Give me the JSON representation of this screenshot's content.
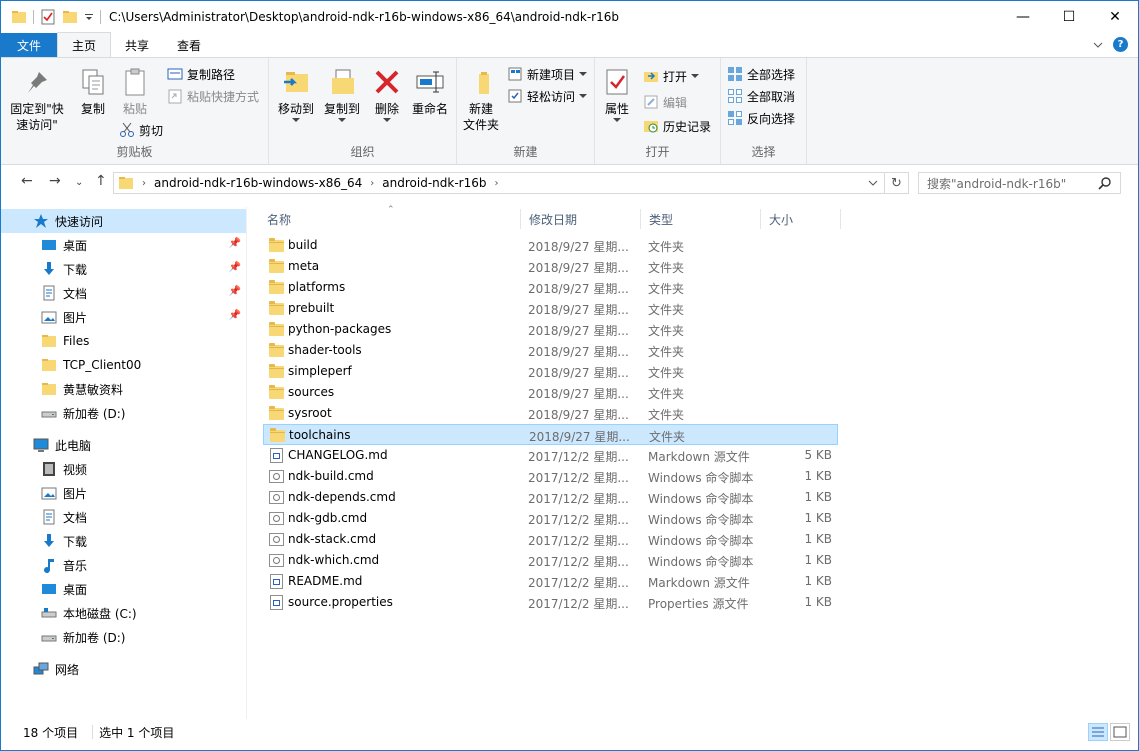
{
  "window": {
    "title": "C:\\Users\\Administrator\\Desktop\\android-ndk-r16b-windows-x86_64\\android-ndk-r16b",
    "minimize": "—",
    "maximize": "☐",
    "close": "✕"
  },
  "tabs": {
    "file": "文件",
    "home": "主页",
    "share": "共享",
    "view": "查看"
  },
  "ribbon": {
    "clipboard": {
      "label": "剪贴板",
      "pin_line1": "固定到\"快",
      "pin_line2": "速访问\"",
      "copy": "复制",
      "paste": "粘贴",
      "copy_path": "复制路径",
      "paste_shortcut": "粘贴快捷方式",
      "cut": "剪切"
    },
    "organize": {
      "label": "组织",
      "move_to": "移动到",
      "copy_to": "复制到",
      "delete": "删除",
      "rename": "重命名"
    },
    "new": {
      "label": "新建",
      "new_folder_line1": "新建",
      "new_folder_line2": "文件夹",
      "new_item": "新建项目",
      "easy_access": "轻松访问"
    },
    "open": {
      "label": "打开",
      "properties": "属性",
      "open": "打开",
      "edit": "编辑",
      "history": "历史记录"
    },
    "select": {
      "label": "选择",
      "select_all": "全部选择",
      "select_none": "全部取消",
      "invert": "反向选择"
    }
  },
  "address": {
    "crumbs": [
      "android-ndk-r16b-windows-x86_64",
      "android-ndk-r16b"
    ],
    "search_placeholder": "搜索\"android-ndk-r16b\""
  },
  "navpane": {
    "quick_access": "快速访问",
    "qa_items": [
      "桌面",
      "下载",
      "文档",
      "图片",
      "Files",
      "TCP_Client00",
      "黄慧敏资料",
      "新加卷 (D:)"
    ],
    "this_pc": "此电脑",
    "pc_items": [
      "视频",
      "图片",
      "文档",
      "下载",
      "音乐",
      "桌面",
      "本地磁盘 (C:)",
      "新加卷 (D:)"
    ],
    "network": "网络"
  },
  "columns": {
    "name": "名称",
    "date": "修改日期",
    "type": "类型",
    "size": "大小"
  },
  "files": [
    {
      "name": "build",
      "date": "2018/9/27 星期...",
      "type": "文件夹",
      "size": "",
      "kind": "folder"
    },
    {
      "name": "meta",
      "date": "2018/9/27 星期...",
      "type": "文件夹",
      "size": "",
      "kind": "folder"
    },
    {
      "name": "platforms",
      "date": "2018/9/27 星期...",
      "type": "文件夹",
      "size": "",
      "kind": "folder"
    },
    {
      "name": "prebuilt",
      "date": "2018/9/27 星期...",
      "type": "文件夹",
      "size": "",
      "kind": "folder"
    },
    {
      "name": "python-packages",
      "date": "2018/9/27 星期...",
      "type": "文件夹",
      "size": "",
      "kind": "folder"
    },
    {
      "name": "shader-tools",
      "date": "2018/9/27 星期...",
      "type": "文件夹",
      "size": "",
      "kind": "folder"
    },
    {
      "name": "simpleperf",
      "date": "2018/9/27 星期...",
      "type": "文件夹",
      "size": "",
      "kind": "folder"
    },
    {
      "name": "sources",
      "date": "2018/9/27 星期...",
      "type": "文件夹",
      "size": "",
      "kind": "folder"
    },
    {
      "name": "sysroot",
      "date": "2018/9/27 星期...",
      "type": "文件夹",
      "size": "",
      "kind": "folder"
    },
    {
      "name": "toolchains",
      "date": "2018/9/27 星期...",
      "type": "文件夹",
      "size": "",
      "kind": "folder"
    },
    {
      "name": "CHANGELOG.md",
      "date": "2017/12/2 星期...",
      "type": "Markdown 源文件",
      "size": "5 KB",
      "kind": "doc"
    },
    {
      "name": "ndk-build.cmd",
      "date": "2017/12/2 星期...",
      "type": "Windows 命令脚本",
      "size": "1 KB",
      "kind": "cmd"
    },
    {
      "name": "ndk-depends.cmd",
      "date": "2017/12/2 星期...",
      "type": "Windows 命令脚本",
      "size": "1 KB",
      "kind": "cmd"
    },
    {
      "name": "ndk-gdb.cmd",
      "date": "2017/12/2 星期...",
      "type": "Windows 命令脚本",
      "size": "1 KB",
      "kind": "cmd"
    },
    {
      "name": "ndk-stack.cmd",
      "date": "2017/12/2 星期...",
      "type": "Windows 命令脚本",
      "size": "1 KB",
      "kind": "cmd"
    },
    {
      "name": "ndk-which.cmd",
      "date": "2017/12/2 星期...",
      "type": "Windows 命令脚本",
      "size": "1 KB",
      "kind": "cmd"
    },
    {
      "name": "README.md",
      "date": "2017/12/2 星期...",
      "type": "Markdown 源文件",
      "size": "1 KB",
      "kind": "doc"
    },
    {
      "name": "source.properties",
      "date": "2017/12/2 星期...",
      "type": "Properties 源文件",
      "size": "1 KB",
      "kind": "doc"
    }
  ],
  "selected_index": 9,
  "status": {
    "count": "18 个项目",
    "selected": "选中 1 个项目"
  },
  "colors": {
    "accent": "#1979ca",
    "selection": "#cce8ff",
    "folder": "#f8d775"
  }
}
